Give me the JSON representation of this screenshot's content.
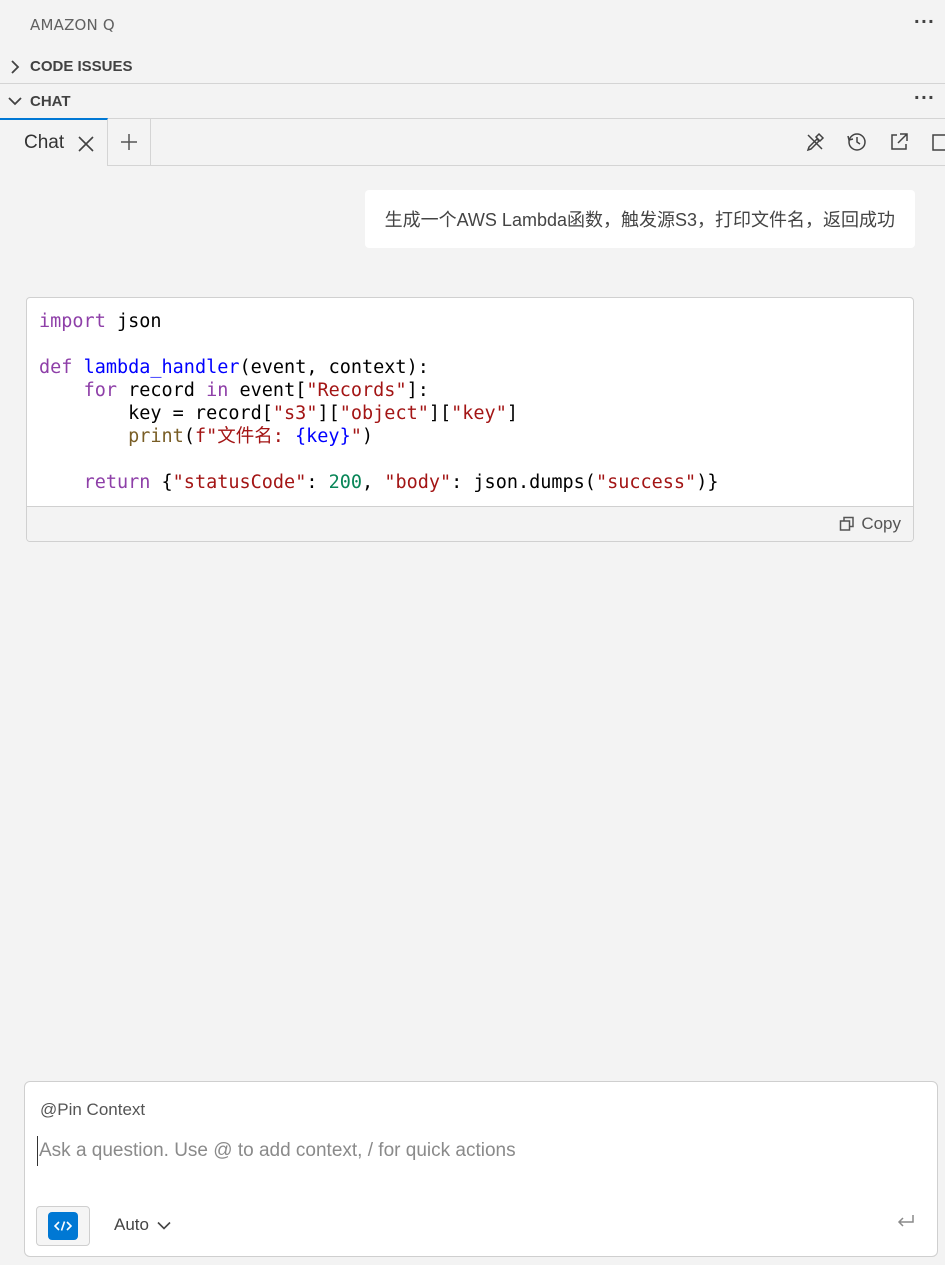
{
  "panel": {
    "title": "AMAZON Q",
    "more_label": "···"
  },
  "sections": {
    "code_issues": {
      "label": "CODE ISSUES",
      "expanded": false
    },
    "chat": {
      "label": "CHAT",
      "expanded": true,
      "more_label": "···"
    }
  },
  "tabs": {
    "active_label": "Chat",
    "toolbar_icons": [
      "tools-icon",
      "history-icon",
      "open-external-icon",
      "new-window-icon"
    ]
  },
  "conversation": {
    "user_message": "生成一个AWS Lambda函数，触发源S3，打印文件名，返回成功",
    "code_block": {
      "language": "python",
      "lines": [
        "import json",
        "",
        "def lambda_handler(event, context):",
        "    for record in event[\"Records\"]:",
        "        key = record[\"s3\"][\"object\"][\"key\"]",
        "        print(f\"文件名: {key}\")",
        "",
        "    return {\"statusCode\": 200, \"body\": json.dumps(\"success\")}"
      ],
      "copy_label": "Copy"
    }
  },
  "composer": {
    "pin_context_label": "@Pin Context",
    "placeholder": "Ask a question. Use @ to add context, / for quick actions",
    "value": "",
    "model_label": "Auto"
  },
  "colors": {
    "accent": "#0078d4",
    "background": "#f3f3f3",
    "keyword": "#8e3fa8",
    "function": "#0000ff",
    "string": "#a31515",
    "number": "#098658"
  }
}
